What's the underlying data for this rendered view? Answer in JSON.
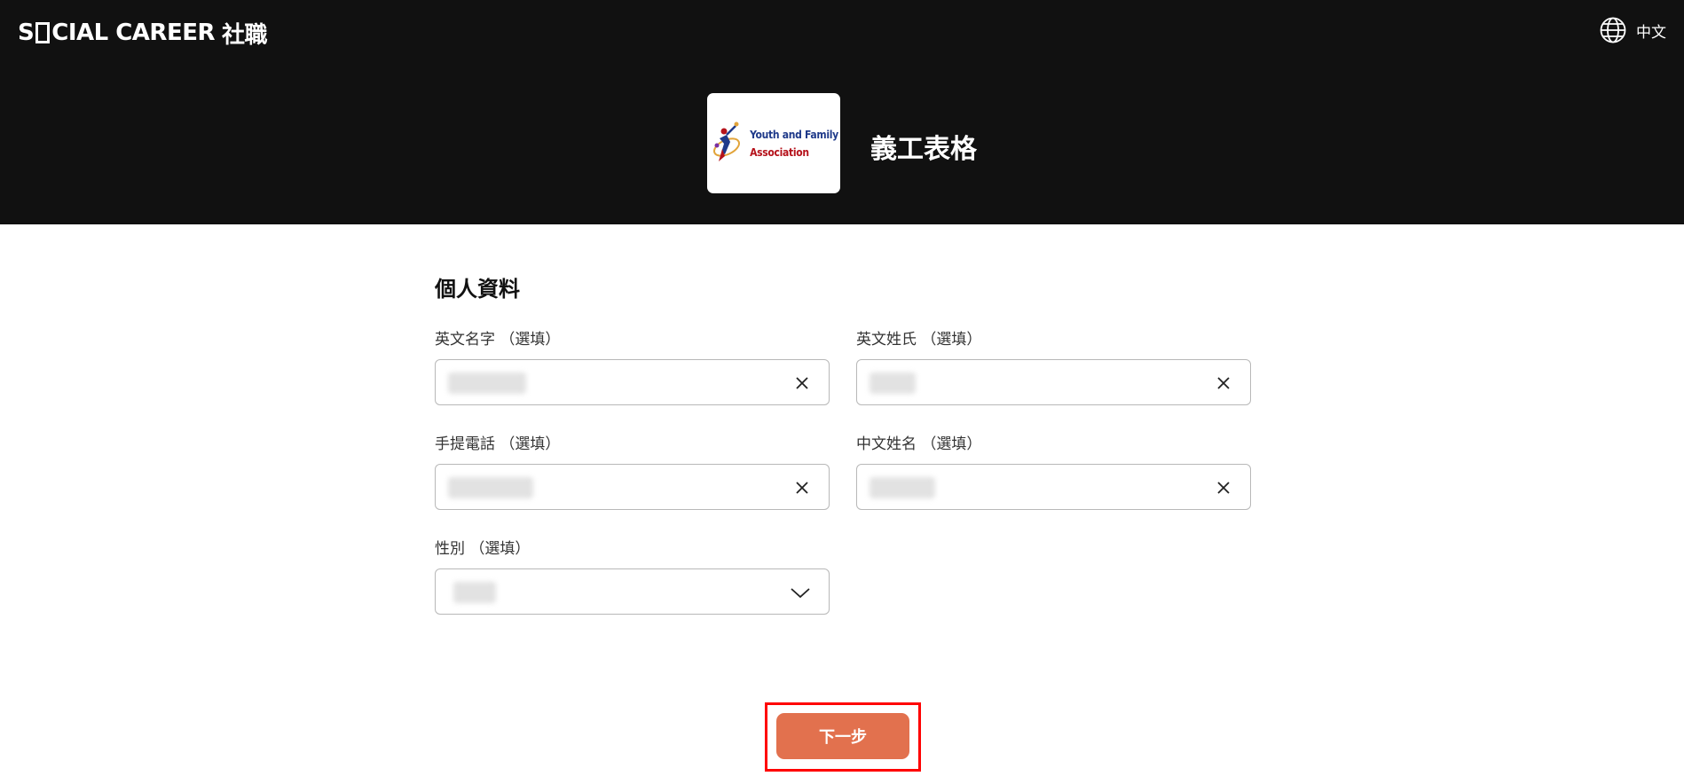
{
  "header": {
    "brand_prefix": "S",
    "brand_suffix": "CIAL CAREER",
    "brand_cjk": "社職",
    "language_label": "中文",
    "logo_line1": "Youth and Family",
    "logo_line2": "Association",
    "form_title": "義工表格"
  },
  "section": {
    "title": "個人資料"
  },
  "fields": {
    "english_first_name": {
      "label": "英文名字 （選填）",
      "value": "●●●●●●"
    },
    "english_last_name": {
      "label": "英文姓氏 （選填）",
      "value": "●●●"
    },
    "mobile_phone": {
      "label": "手提電話 （選填）",
      "value": "●●●●●●●"
    },
    "chinese_name": {
      "label": "中文姓名 （選填）",
      "value": "●●●●●"
    },
    "gender": {
      "label": "性別 （選填）",
      "value": "●●●"
    }
  },
  "actions": {
    "next_label": "下一步"
  },
  "colors": {
    "header_bg": "#111111",
    "accent": "#e2714e",
    "highlight": "#ff0000"
  },
  "icons": {
    "language": "globe-icon",
    "clear": "close-icon",
    "dropdown": "chevron-down-icon"
  }
}
